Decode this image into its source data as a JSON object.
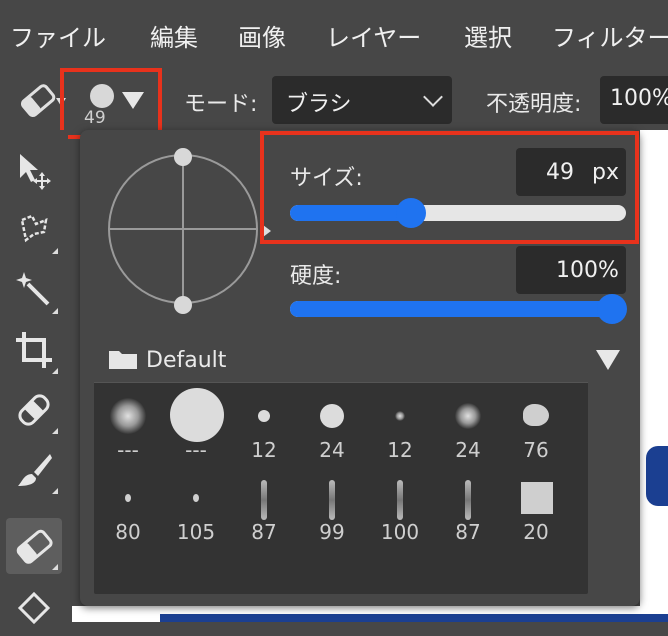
{
  "menu": {
    "items": [
      "ファイル",
      "編集",
      "画像",
      "レイヤー",
      "選択",
      "フィルター"
    ]
  },
  "options": {
    "brush_size_value": "49",
    "mode_label": "モード:",
    "mode_value": "ブラシ",
    "opacity_label": "不透明度:",
    "opacity_value": "100%"
  },
  "panel": {
    "size_label": "サイズ:",
    "size_value": "49",
    "size_unit": "px",
    "size_level": 0.36,
    "hardness_label": "硬度:",
    "hardness_value": "100%",
    "hardness_level": 1.0,
    "library": {
      "title": "Default",
      "presets": [
        {
          "label": "---",
          "icon": "soft-round-brush-icon"
        },
        {
          "label": "---",
          "icon": "large-round-brush-icon"
        },
        {
          "label": "12",
          "icon": "hard-round-brush-icon"
        },
        {
          "label": "24",
          "icon": "hard-round-brush-icon"
        },
        {
          "label": "12",
          "icon": "soft-round-brush-icon"
        },
        {
          "label": "24",
          "icon": "soft-round-brush-icon"
        },
        {
          "label": "76",
          "icon": "textured-brush-icon"
        },
        {
          "label": "80",
          "icon": "small-textured-brush-icon"
        },
        {
          "label": "105",
          "icon": "small-textured-brush-icon"
        },
        {
          "label": "87",
          "icon": "stroke-brush-icon"
        },
        {
          "label": "99",
          "icon": "stroke-brush-icon"
        },
        {
          "label": "100",
          "icon": "stroke-brush-icon"
        },
        {
          "label": "87",
          "icon": "stroke-brush-icon"
        },
        {
          "label": "20",
          "icon": "square-brush-icon"
        }
      ]
    }
  },
  "colors": {
    "highlight": "#e8321c",
    "accent": "#1f73f0",
    "background": "#474747",
    "field": "#2b2b2b"
  }
}
